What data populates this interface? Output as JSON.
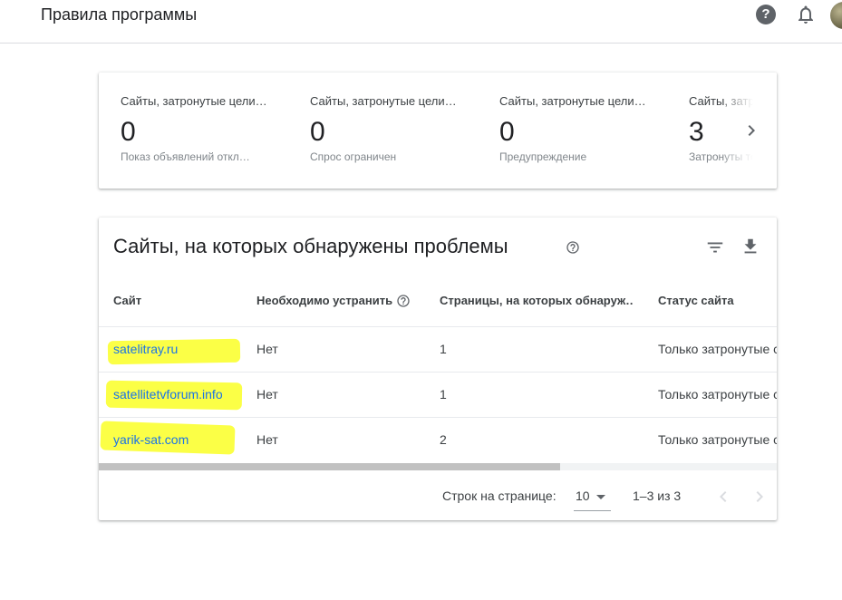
{
  "header": {
    "title": "Правила программы",
    "help_glyph": "?"
  },
  "summary": {
    "metrics": [
      {
        "label": "Сайты, затронутые цели…",
        "value": "0",
        "sub": "Показ объявлений откл…"
      },
      {
        "label": "Сайты, затронутые цели…",
        "value": "0",
        "sub": "Спрос ограничен"
      },
      {
        "label": "Сайты, затронутые цели…",
        "value": "0",
        "sub": "Предупреждение"
      },
      {
        "label": "Сайты, затронутые цели…",
        "value": "3",
        "sub": "Затронуты только"
      }
    ]
  },
  "table": {
    "title": "Сайты, на которых обнаружены проблемы",
    "columns": [
      "Сайт",
      "Необходимо устранить",
      "Страницы, на которых обнаруж…",
      "Статус сайта"
    ],
    "rows": [
      {
        "site": "satelitray.ru",
        "must_fix": "Нет",
        "pages": "1",
        "status": "Только затронутые с"
      },
      {
        "site": "satellitetvforum.info",
        "must_fix": "Нет",
        "pages": "1",
        "status": "Только затронутые с"
      },
      {
        "site": "yarik-sat.com",
        "must_fix": "Нет",
        "pages": "2",
        "status": "Только затронутые с"
      }
    ],
    "rows_per_page_label": "Строк на странице:",
    "rows_per_page_value": "10",
    "range_label": "1–3 из 3"
  },
  "colors": {
    "highlight": "#fbff3c",
    "link": "#1a73e8",
    "icon": "#5f6368"
  }
}
